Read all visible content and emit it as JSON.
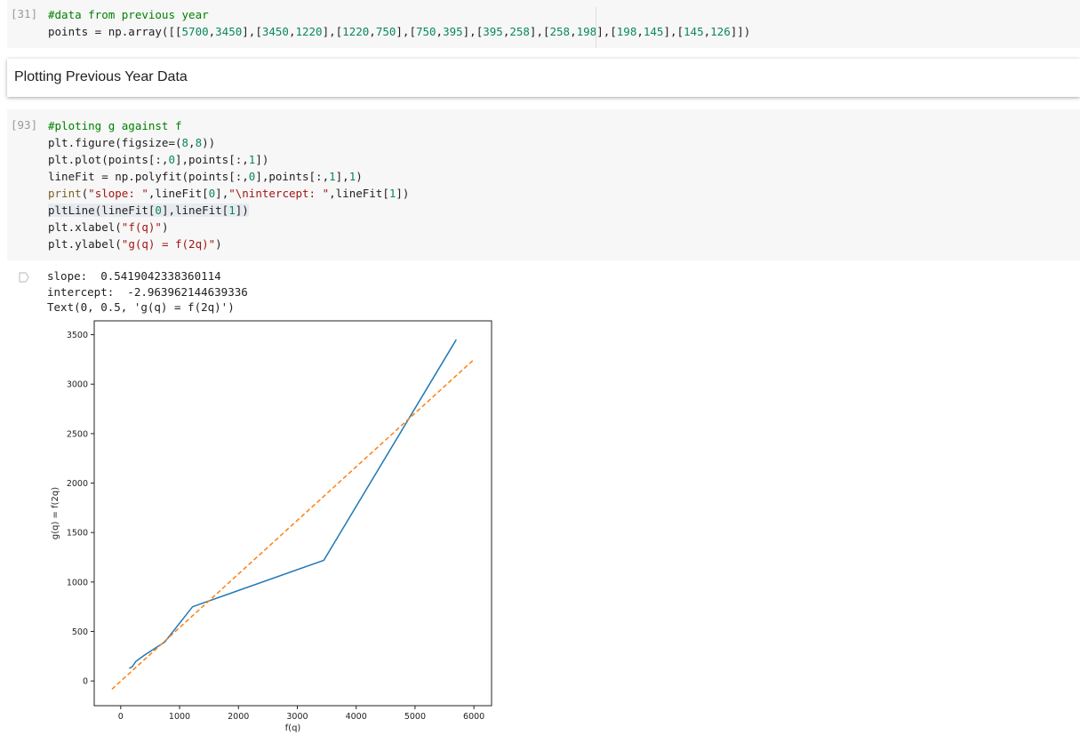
{
  "cell1": {
    "exec_count": "[31]",
    "lines": [
      [
        {
          "t": "#data from previous year",
          "c": "comment"
        }
      ],
      [
        {
          "t": "points = np.array([[",
          "c": ""
        },
        {
          "t": "5700",
          "c": "num"
        },
        {
          "t": ",",
          "c": ""
        },
        {
          "t": "3450",
          "c": "num"
        },
        {
          "t": "],[",
          "c": ""
        },
        {
          "t": "3450",
          "c": "num"
        },
        {
          "t": ",",
          "c": ""
        },
        {
          "t": "1220",
          "c": "num"
        },
        {
          "t": "],[",
          "c": ""
        },
        {
          "t": "1220",
          "c": "num"
        },
        {
          "t": ",",
          "c": ""
        },
        {
          "t": "750",
          "c": "num"
        },
        {
          "t": "],[",
          "c": ""
        },
        {
          "t": "750",
          "c": "num"
        },
        {
          "t": ",",
          "c": ""
        },
        {
          "t": "395",
          "c": "num"
        },
        {
          "t": "],[",
          "c": ""
        },
        {
          "t": "395",
          "c": "num"
        },
        {
          "t": ",",
          "c": ""
        },
        {
          "t": "258",
          "c": "num"
        },
        {
          "t": "],[",
          "c": ""
        },
        {
          "t": "258",
          "c": "num"
        },
        {
          "t": ",",
          "c": ""
        },
        {
          "t": "198",
          "c": "num"
        },
        {
          "t": "],[",
          "c": ""
        },
        {
          "t": "198",
          "c": "num"
        },
        {
          "t": ",",
          "c": ""
        },
        {
          "t": "145",
          "c": "num"
        },
        {
          "t": "],[",
          "c": ""
        },
        {
          "t": "145",
          "c": "num"
        },
        {
          "t": ",",
          "c": ""
        },
        {
          "t": "126",
          "c": "num"
        },
        {
          "t": "]])",
          "c": ""
        }
      ]
    ]
  },
  "text_cell": {
    "heading": "Plotting Previous Year Data"
  },
  "cell2": {
    "exec_count": "[93]",
    "lines": [
      [
        {
          "t": "#ploting g against f",
          "c": "comment"
        }
      ],
      [
        {
          "t": "plt.figure(figsize=(",
          "c": ""
        },
        {
          "t": "8",
          "c": "num"
        },
        {
          "t": ",",
          "c": ""
        },
        {
          "t": "8",
          "c": "num"
        },
        {
          "t": "))",
          "c": ""
        }
      ],
      [
        {
          "t": "plt.plot(points[:,",
          "c": ""
        },
        {
          "t": "0",
          "c": "num"
        },
        {
          "t": "],points[:,",
          "c": ""
        },
        {
          "t": "1",
          "c": "num"
        },
        {
          "t": "])",
          "c": ""
        }
      ],
      [
        {
          "t": "lineFit = np.polyfit(points[:,",
          "c": ""
        },
        {
          "t": "0",
          "c": "num"
        },
        {
          "t": "],points[:,",
          "c": ""
        },
        {
          "t": "1",
          "c": "num"
        },
        {
          "t": "],",
          "c": ""
        },
        {
          "t": "1",
          "c": "num"
        },
        {
          "t": ")",
          "c": ""
        }
      ],
      [
        {
          "t": "print",
          "c": "builtin"
        },
        {
          "t": "(",
          "c": ""
        },
        {
          "t": "\"slope: \"",
          "c": "str"
        },
        {
          "t": ",lineFit[",
          "c": ""
        },
        {
          "t": "0",
          "c": "num"
        },
        {
          "t": "],",
          "c": ""
        },
        {
          "t": "\"\\nintercept: \"",
          "c": "str"
        },
        {
          "t": ",lineFit[",
          "c": ""
        },
        {
          "t": "1",
          "c": "num"
        },
        {
          "t": "])",
          "c": ""
        }
      ],
      [
        {
          "t": "pltLine(lineFit[",
          "c": "hl"
        },
        {
          "t": "0",
          "c": "hlnum"
        },
        {
          "t": "],lineFit[",
          "c": "hl"
        },
        {
          "t": "1",
          "c": "hlnum"
        },
        {
          "t": "])",
          "c": "hl"
        }
      ],
      [
        {
          "t": "plt.xlabel(",
          "c": ""
        },
        {
          "t": "\"f(q)\"",
          "c": "str"
        },
        {
          "t": ")",
          "c": ""
        }
      ],
      [
        {
          "t": "plt.ylabel(",
          "c": ""
        },
        {
          "t": "\"g(q) = f(2q)\"",
          "c": "str"
        },
        {
          "t": ")",
          "c": ""
        }
      ]
    ]
  },
  "output": {
    "lines": [
      "slope:  0.5419042338360114",
      "intercept:  -2.963962144639336",
      "Text(0, 0.5, 'g(q) = f(2q)')"
    ]
  },
  "chart_data": {
    "type": "line",
    "xlabel": "f(q)",
    "ylabel": "g(q) = f(2q)",
    "xlim": [
      -450,
      6300
    ],
    "ylim": [
      -250,
      3640
    ],
    "xticks": [
      0,
      1000,
      2000,
      3000,
      4000,
      5000,
      6000
    ],
    "yticks": [
      0,
      500,
      1000,
      1500,
      2000,
      2500,
      3000,
      3500
    ],
    "series": [
      {
        "style": "solid",
        "color": "#1f77b4",
        "x": [
          5700,
          3450,
          1220,
          750,
          395,
          258,
          198,
          145
        ],
        "y": [
          3450,
          1220,
          750,
          395,
          258,
          198,
          145,
          126
        ]
      },
      {
        "style": "dashed",
        "color": "#ff7f0e",
        "x": [
          -150,
          6000
        ],
        "y": [
          -84,
          3248
        ]
      }
    ]
  }
}
